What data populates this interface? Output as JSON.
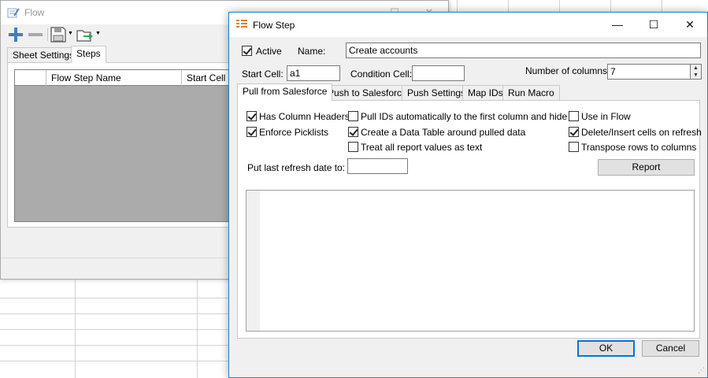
{
  "flow_window": {
    "title": "Flow",
    "tabs": [
      {
        "label": "Sheet Settings"
      },
      {
        "label": "Steps"
      }
    ],
    "grid_columns": [
      "Flow Step Name",
      "Start Cell"
    ],
    "toolbar": [
      "add-icon",
      "remove-icon",
      "save-icon",
      "open-folder-icon"
    ]
  },
  "dialog": {
    "title": "Flow Step",
    "active": {
      "label": "Active",
      "checked": true
    },
    "name": {
      "label": "Name:",
      "value": "Create accounts"
    },
    "start_cell": {
      "label": "Start Cell:",
      "value": "a1"
    },
    "condition_cell": {
      "label": "Condition Cell:",
      "value": ""
    },
    "num_columns": {
      "label": "Number of columns:",
      "value": "7"
    },
    "tabs": [
      {
        "label": "Pull from Salesforce"
      },
      {
        "label": "Push to Salesforce"
      },
      {
        "label": "Push Settings"
      },
      {
        "label": "Map IDs"
      },
      {
        "label": "Run Macro"
      }
    ],
    "options": {
      "has_column_headers": {
        "label": "Has Column Headers",
        "checked": true
      },
      "enforce_picklists": {
        "label": "Enforce Picklists",
        "checked": true
      },
      "pull_ids": {
        "label": "Pull IDs automatically to the first column and hide it",
        "checked": false
      },
      "create_data_table": {
        "label": "Create a Data Table around pulled data",
        "checked": true
      },
      "treat_as_text": {
        "label": "Treat all report values as text",
        "checked": false
      },
      "use_in_flow": {
        "label": "Use in Flow",
        "checked": false
      },
      "delete_insert": {
        "label": "Delete/Insert cells on refresh",
        "checked": true
      },
      "transpose": {
        "label": "Transpose rows to columns",
        "checked": false
      }
    },
    "refresh_date": {
      "label": "Put last refresh date to:",
      "value": ""
    },
    "report_button": "Report",
    "ok_button": "OK",
    "cancel_button": "Cancel"
  },
  "colors": {
    "accent": "#0078d7",
    "dialog_border": "#1883d7",
    "grid_bg": "#ababab"
  }
}
